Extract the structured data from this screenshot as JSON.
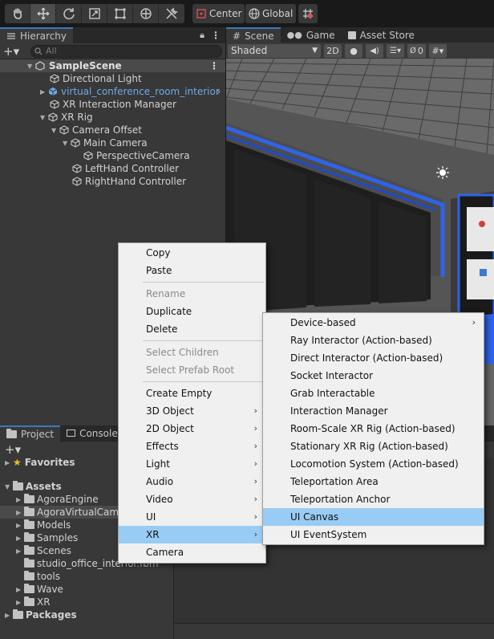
{
  "toolbar": {
    "tools": [
      "hand-icon",
      "move-icon",
      "rotate-icon",
      "scale-icon",
      "rect-icon",
      "transform-icon",
      "custom-tool-icon"
    ],
    "pivot_label": "Center",
    "space_label": "Global"
  },
  "hierarchy": {
    "tab_label": "Hierarchy",
    "search_placeholder": "All",
    "scene_name": "SampleScene",
    "items": [
      {
        "label": "Directional Light"
      },
      {
        "label": "virtual_conference_room_interior"
      },
      {
        "label": "XR Interaction Manager"
      },
      {
        "label": "XR Rig"
      },
      {
        "label": "Camera Offset"
      },
      {
        "label": "Main Camera"
      },
      {
        "label": "PerspectiveCamera"
      },
      {
        "label": "LeftHand Controller"
      },
      {
        "label": "RightHand Controller"
      }
    ]
  },
  "scene": {
    "tabs": [
      {
        "label": "Scene"
      },
      {
        "label": "Game"
      },
      {
        "label": "Asset Store"
      }
    ],
    "shading_mode": "Shaded",
    "mode_2d": "2D",
    "hidden_count": "0"
  },
  "project": {
    "tabs": [
      {
        "label": "Project"
      },
      {
        "label": "Console"
      }
    ],
    "favorites_label": "Favorites",
    "assets_label": "Assets",
    "asset_items": [
      {
        "label": "AgoraEngine"
      },
      {
        "label": "AgoraVirtualCame"
      },
      {
        "label": "Models"
      },
      {
        "label": "Samples"
      },
      {
        "label": "Scenes"
      },
      {
        "label": "studio_office_interior.fbm"
      },
      {
        "label": "tools"
      },
      {
        "label": "Wave"
      },
      {
        "label": "XR"
      }
    ],
    "packages_label": "Packages"
  },
  "context_menu": {
    "items": [
      {
        "label": "Copy"
      },
      {
        "label": "Paste"
      },
      {
        "label": "Rename"
      },
      {
        "label": "Duplicate"
      },
      {
        "label": "Delete"
      },
      {
        "label": "Select Children"
      },
      {
        "label": "Select Prefab Root"
      },
      {
        "label": "Create Empty"
      },
      {
        "label": "3D Object"
      },
      {
        "label": "2D Object"
      },
      {
        "label": "Effects"
      },
      {
        "label": "Light"
      },
      {
        "label": "Audio"
      },
      {
        "label": "Video"
      },
      {
        "label": "UI"
      },
      {
        "label": "XR"
      },
      {
        "label": "Camera"
      }
    ]
  },
  "xr_submenu": {
    "items": [
      {
        "label": "Device-based"
      },
      {
        "label": "Ray Interactor (Action-based)"
      },
      {
        "label": "Direct Interactor (Action-based)"
      },
      {
        "label": "Socket Interactor"
      },
      {
        "label": "Grab Interactable"
      },
      {
        "label": "Interaction Manager"
      },
      {
        "label": "Room-Scale XR Rig (Action-based)"
      },
      {
        "label": "Stationary XR Rig (Action-based)"
      },
      {
        "label": "Locomotion System (Action-based)"
      },
      {
        "label": "Teleportation Area"
      },
      {
        "label": "Teleportation Anchor"
      },
      {
        "label": "UI Canvas"
      },
      {
        "label": "UI EventSystem"
      }
    ]
  },
  "colors": {
    "accent_blue": "#3a79bb",
    "menu_highlight": "#99ccf4",
    "prefab_blue": "#6ca9e8"
  }
}
